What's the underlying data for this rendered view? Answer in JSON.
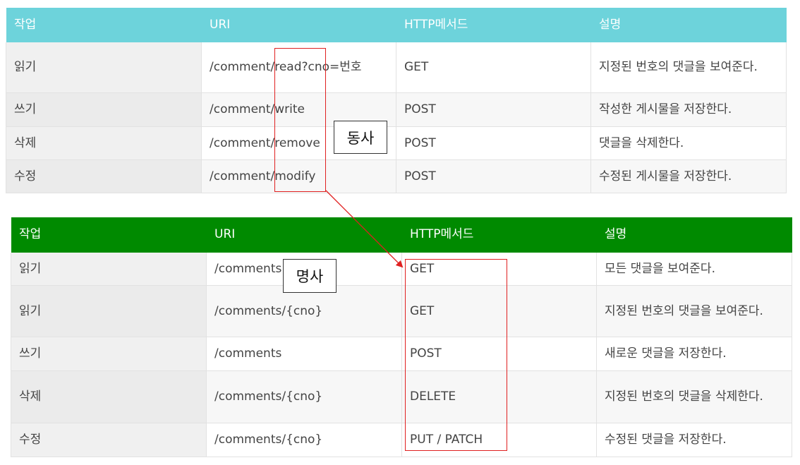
{
  "table1": {
    "headers": [
      "작업",
      "URI",
      "HTTP메서드",
      "설명"
    ],
    "rows": [
      [
        "읽기",
        "/comment/read?cno=번호",
        "GET",
        "지정된 번호의 댓글을 보여준다."
      ],
      [
        "쓰기",
        "/comment/write",
        "POST",
        "작성한 게시물을 저장한다."
      ],
      [
        "삭제",
        "/comment/remove",
        "POST",
        "댓글을 삭제한다."
      ],
      [
        "수정",
        "/comment/modify",
        "POST",
        "수정된 게시물을 저장한다."
      ]
    ]
  },
  "table2": {
    "headers": [
      "작업",
      "URI",
      "HTTP메서드",
      "설명"
    ],
    "rows": [
      [
        "읽기",
        "/comments",
        "GET",
        "모든 댓글을 보여준다."
      ],
      [
        "읽기",
        "/comments/{cno}",
        "GET",
        "지정된 번호의 댓글을 보여준다."
      ],
      [
        "쓰기",
        "/comments",
        "POST",
        "새로운 댓글을 저장한다."
      ],
      [
        "삭제",
        "/comments/{cno}",
        "DELETE",
        "지정된 번호의 댓글을 삭제한다."
      ],
      [
        "수정",
        "/comments/{cno}",
        "PUT / PATCH",
        "수정된 댓글을 저장한다."
      ]
    ]
  },
  "annotations": {
    "verb_label": "동사",
    "noun_label": "명사",
    "highlight_color": "#e02020"
  }
}
